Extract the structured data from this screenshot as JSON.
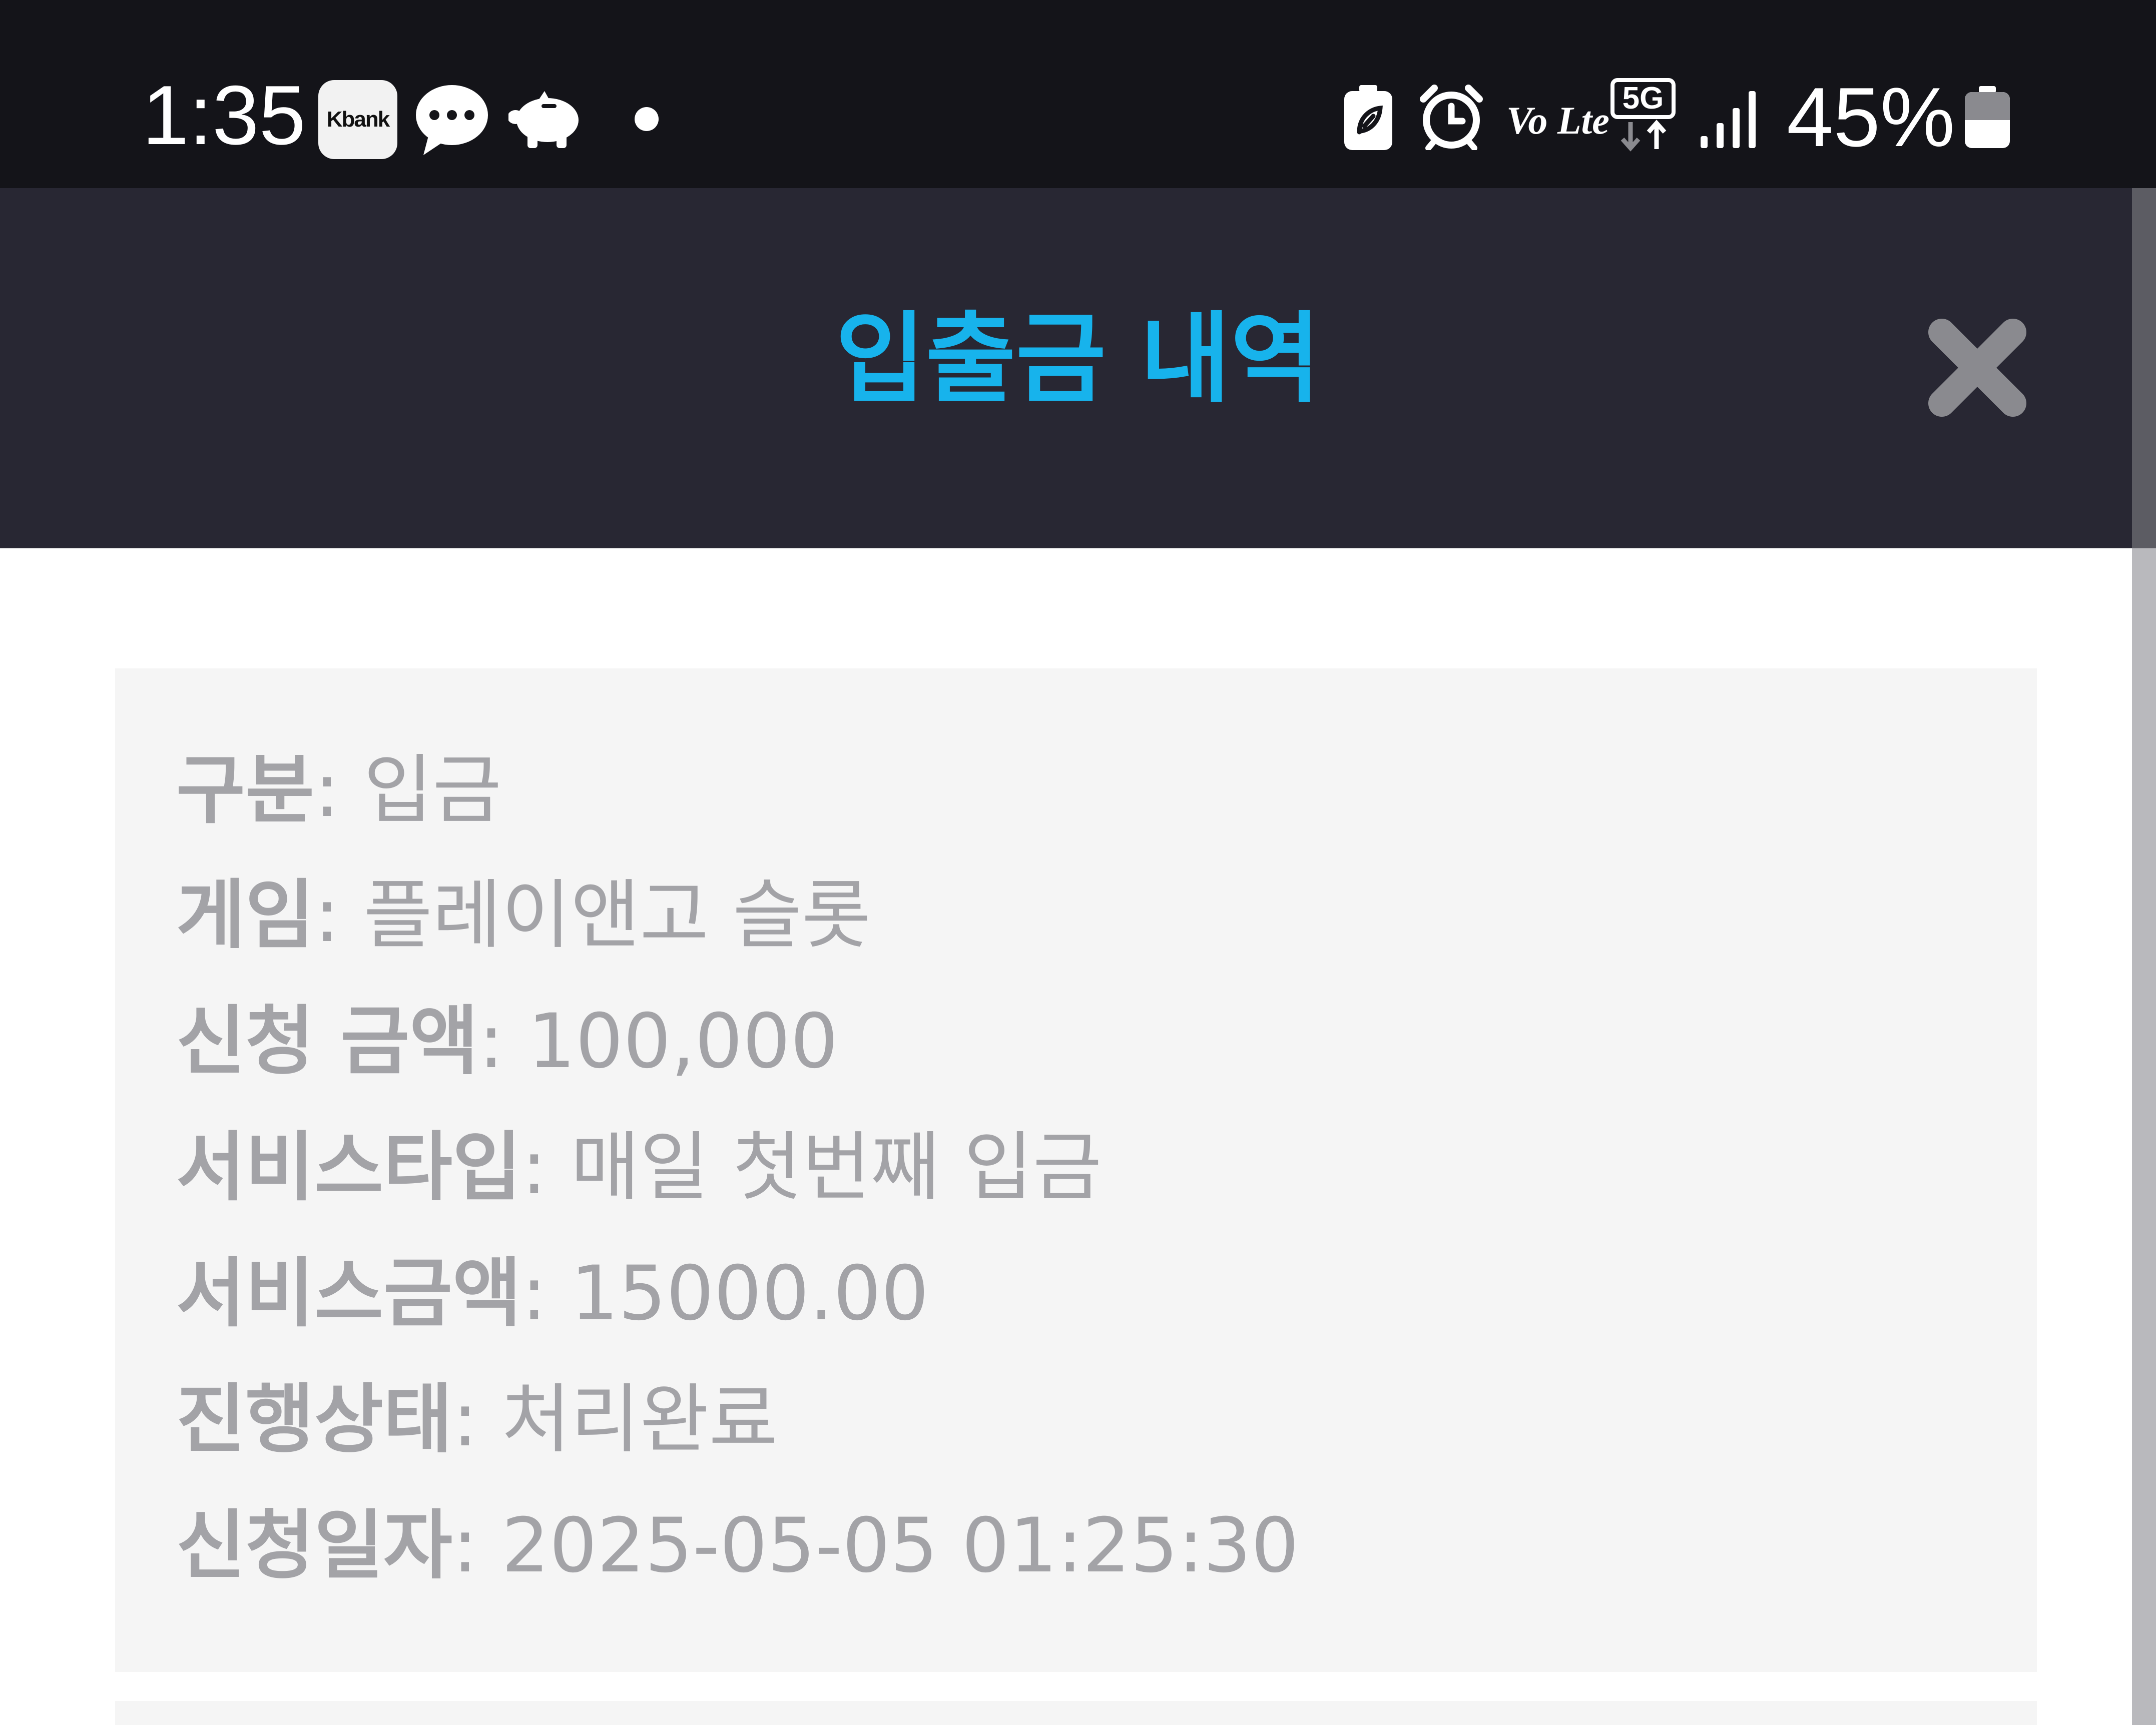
{
  "status_bar": {
    "time": "1:35",
    "kbank_label": "Kbank",
    "network_badge": "5G",
    "volte_label": "Vo Lte",
    "battery_percent": "45%",
    "battery_level": 0.45,
    "icons": [
      "kbank-icon",
      "message-bubble-icon",
      "piggy-bank-icon",
      "notification-dot-icon",
      "battery-saver-icon",
      "alarm-icon",
      "volte-icon",
      "5g-icon",
      "signal-icon",
      "battery-icon"
    ]
  },
  "header": {
    "title": "입출금 내역",
    "title_color": "#17b3ec",
    "close_icon": "close-icon"
  },
  "details": [
    {
      "label": "구분",
      "value": "입금"
    },
    {
      "label": "게임",
      "value": "플레이앤고 슬롯"
    },
    {
      "label": "신청 금액",
      "value": "100,000"
    },
    {
      "label": "서비스타입",
      "value": "매일 첫번째 입금"
    },
    {
      "label": "서비스금액",
      "value": "15000.00"
    },
    {
      "label": "진행상태",
      "value": "처리완료"
    },
    {
      "label": "신청일자",
      "value": "2025-05-05 01:25:30"
    }
  ]
}
